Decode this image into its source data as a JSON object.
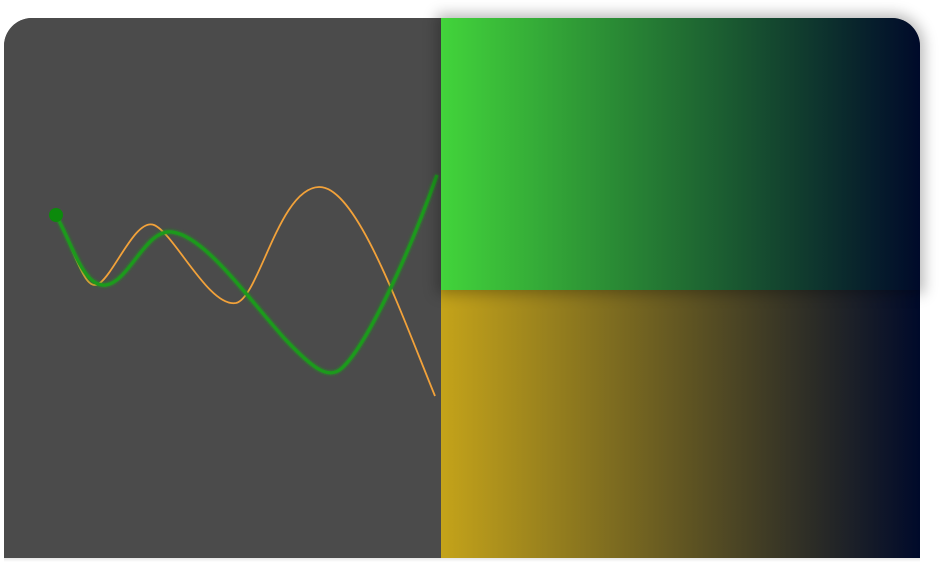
{
  "colors": {
    "canvas_background": "#4b4b4b",
    "green_curve": "#1f9a1f",
    "green_handle": "#0c8a0c",
    "orange_curve": "#f2a23a",
    "swatch_top_start": "#42d43b",
    "swatch_top_end": "#000a2a",
    "swatch_bottom_start": "#c4a31a",
    "swatch_bottom_end": "#000a2a"
  },
  "curves": {
    "green": {
      "name": "green",
      "handle": "circle"
    },
    "orange": {
      "name": "orange"
    }
  }
}
